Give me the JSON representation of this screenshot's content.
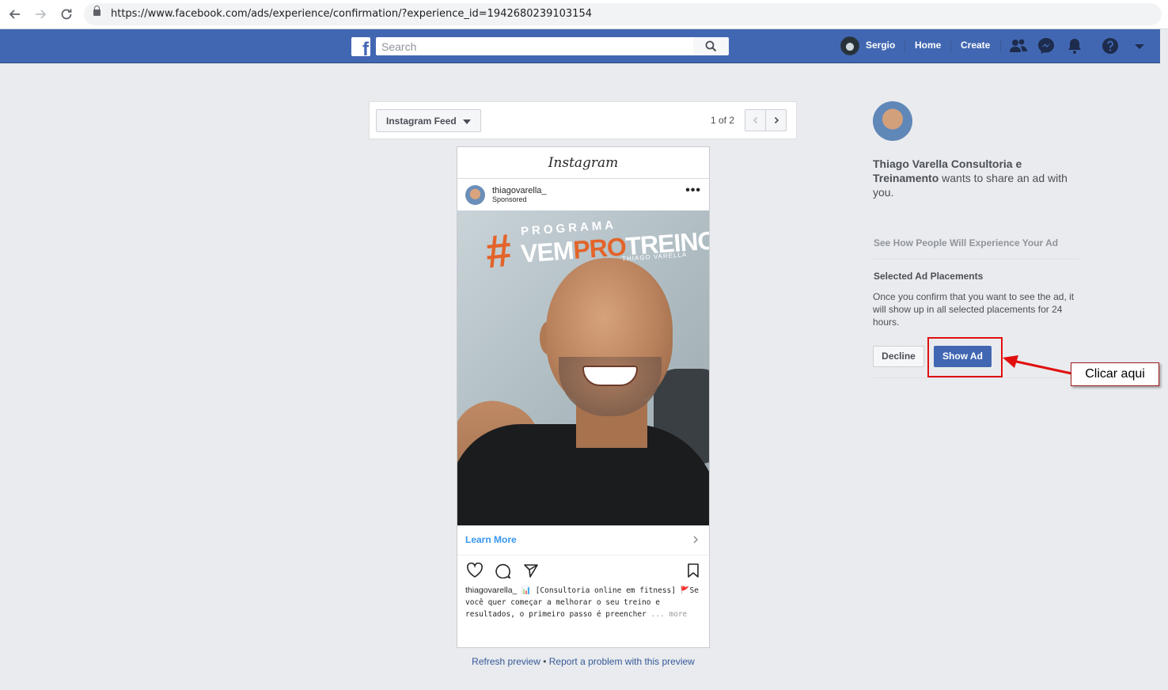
{
  "browser": {
    "url": "https://www.facebook.com/ads/experience/confirmation/?experience_id=1942680239103154"
  },
  "header": {
    "search_placeholder": "Search",
    "user_name": "Sergio",
    "nav": [
      "Home",
      "Create"
    ]
  },
  "preview": {
    "placement": "Instagram Feed",
    "page_count": "1 of 2",
    "app_name": "Instagram",
    "post": {
      "username": "thiagovarella_",
      "sponsored": "Sponsored",
      "media_text": {
        "line1": "PROGRAMA",
        "hash": "#",
        "word_a": "VEM",
        "word_b": "PRO",
        "word_c": "TREINO",
        "signature": "THIAGO VARELLA"
      },
      "cta": "Learn More",
      "caption_user": "thiagovarella_",
      "caption_body": "📊 [Consultoria online em fitness] 🚩Se você quer começar a melhorar o seu treino e resultados, o primeiro passo é preencher",
      "caption_more": "... more"
    },
    "links": {
      "refresh": "Refresh preview",
      "separator": " • ",
      "report": "Report a problem with this preview"
    }
  },
  "sidebar": {
    "page_name": "Thiago Varella Consultoria e Treinamento",
    "share_suffix": " wants to share an ad with you.",
    "see_how": "See How People Will Experience Your Ad",
    "placements_title": "Selected Ad Placements",
    "placements_desc": "Once you confirm that you want to see the ad, it will show up in all selected placements for 24 hours.",
    "decline": "Decline",
    "show_ad": "Show Ad"
  },
  "annotation": {
    "callout": "Clicar aqui",
    "color": "#e10f0f"
  },
  "colors": {
    "facebook_blue": "#4267b2",
    "page_bg": "#e9ebee",
    "link": "#365899",
    "instagram_cta": "#3897f0"
  }
}
